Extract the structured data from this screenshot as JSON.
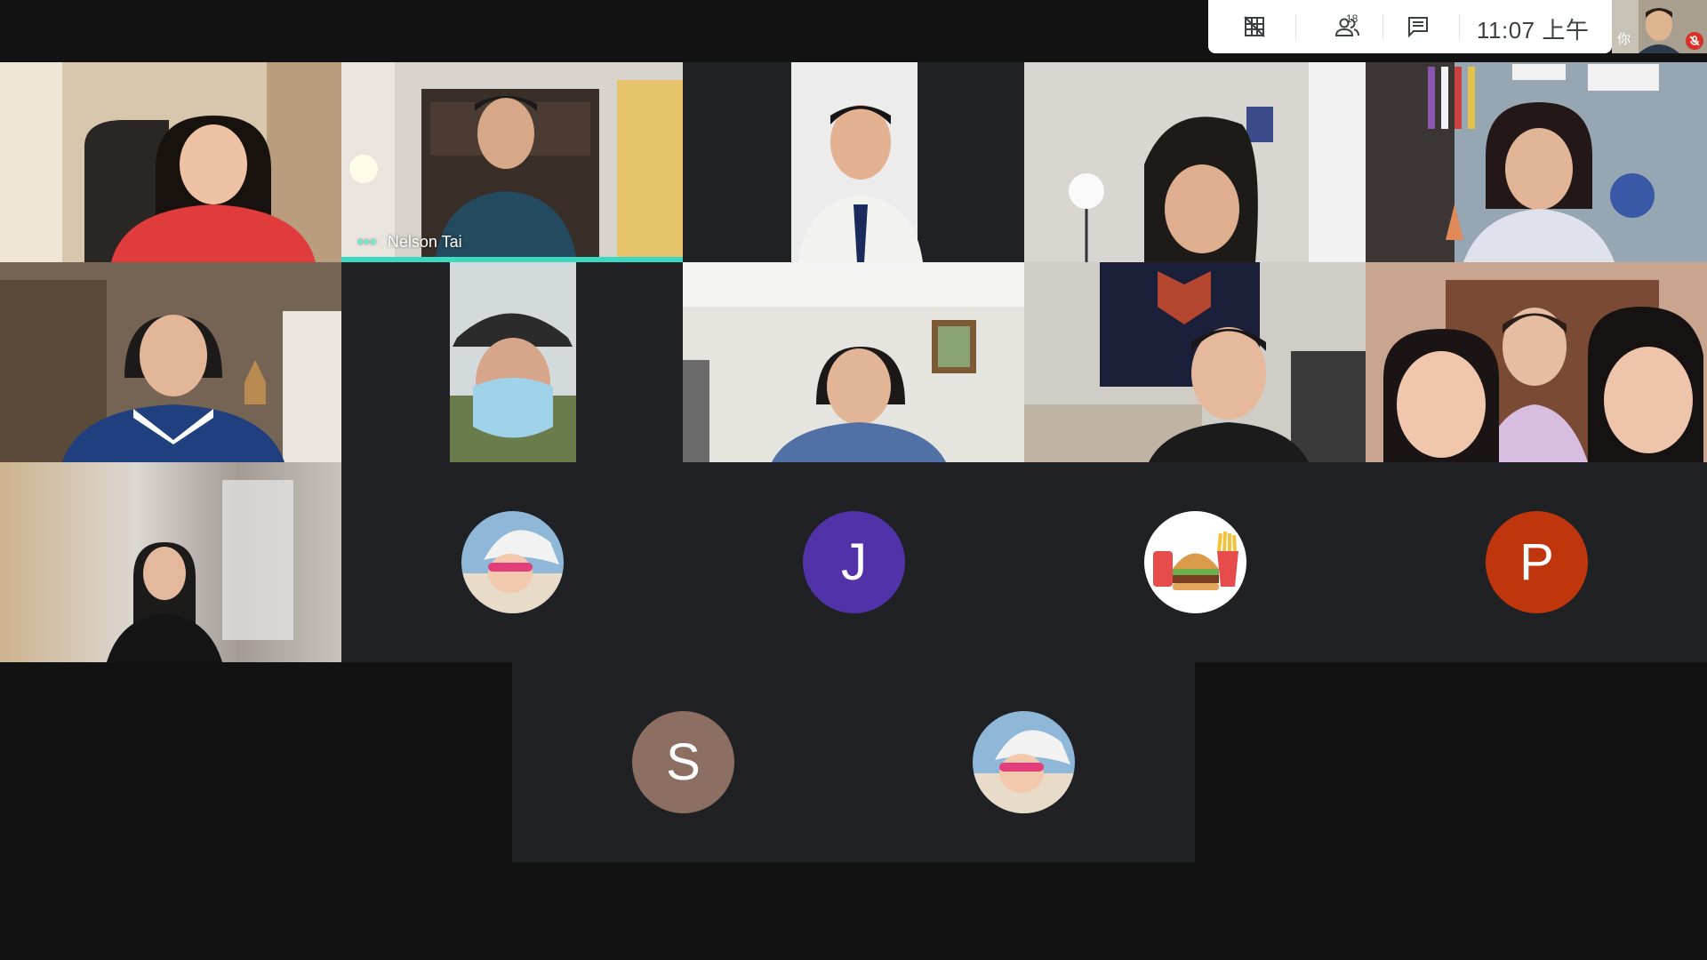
{
  "header": {
    "people_count": "18",
    "clock": "11:07 上午",
    "self_label": "你"
  },
  "participants": {
    "active_speaker_name": "Nelson Tai"
  },
  "avatars": [
    {
      "letter": "",
      "kind": "photo-baby"
    },
    {
      "letter": "J",
      "color": "#5132a8"
    },
    {
      "letter": "",
      "kind": "photo-burger"
    },
    {
      "letter": "P",
      "color": "#bf360c"
    },
    {
      "letter": "S",
      "color": "#8d6e63"
    },
    {
      "letter": "",
      "kind": "photo-baby"
    }
  ],
  "colors": {
    "background": "#121212",
    "panel": "#202124",
    "speaker_accent": "#3ad9c0",
    "mute_red": "#d93025"
  }
}
